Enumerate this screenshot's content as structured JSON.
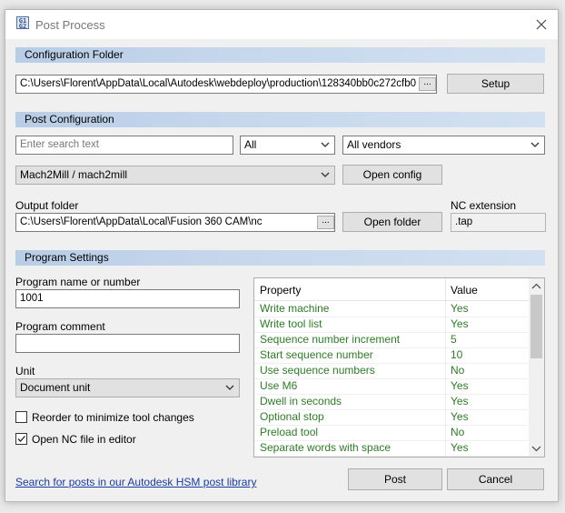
{
  "window": {
    "title": "Post Process",
    "icon": "post-process-app-icon"
  },
  "config_folder": {
    "header": "Configuration Folder",
    "path": "C:\\Users\\Florent\\AppData\\Local\\Autodesk\\webdeploy\\production\\128340bb0c272cfb0",
    "browse_label": "...",
    "setup_label": "Setup"
  },
  "post_config": {
    "header": "Post Configuration",
    "search_placeholder": "Enter search text",
    "filter_value": "All",
    "vendor_value": "All vendors",
    "post_value": "Mach2Mill / mach2mill",
    "open_config_label": "Open config",
    "output_folder_label": "Output folder",
    "output_folder_path": "C:\\Users\\Florent\\AppData\\Local\\Fusion 360 CAM\\nc",
    "browse_label": "...",
    "open_folder_label": "Open folder",
    "nc_extension_label": "NC extension",
    "nc_extension_value": ".tap"
  },
  "program_settings": {
    "header": "Program Settings",
    "name_label": "Program name or number",
    "name_value": "1001",
    "comment_label": "Program comment",
    "comment_value": "",
    "unit_label": "Unit",
    "unit_value": "Document unit",
    "reorder_label": "Reorder to minimize tool changes",
    "reorder_checked": false,
    "open_nc_label": "Open NC file in editor",
    "open_nc_checked": true
  },
  "properties": {
    "col_property": "Property",
    "col_value": "Value",
    "rows": [
      {
        "name": "Write machine",
        "value": "Yes"
      },
      {
        "name": "Write tool list",
        "value": "Yes"
      },
      {
        "name": "Sequence number increment",
        "value": "5"
      },
      {
        "name": "Start sequence number",
        "value": "10"
      },
      {
        "name": "Use sequence numbers",
        "value": "No"
      },
      {
        "name": "Use M6",
        "value": "Yes"
      },
      {
        "name": "Dwell in seconds",
        "value": "Yes"
      },
      {
        "name": "Optional stop",
        "value": "Yes"
      },
      {
        "name": "Preload tool",
        "value": "No"
      },
      {
        "name": "Separate words with space",
        "value": "Yes"
      }
    ]
  },
  "footer": {
    "library_link": "Search for posts in our Autodesk HSM post library",
    "post_label": "Post",
    "cancel_label": "Cancel"
  },
  "colors": {
    "section_header": "#c6d7ec",
    "property_text": "#2c7d24",
    "link": "#1a3aa8"
  }
}
